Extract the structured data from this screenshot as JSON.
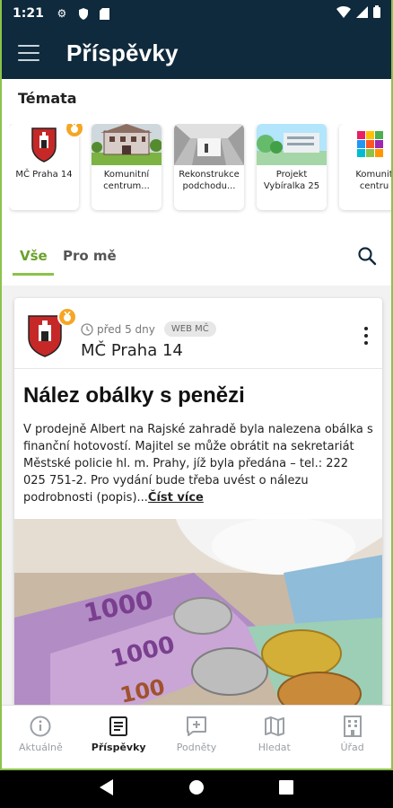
{
  "status": {
    "time": "1:21"
  },
  "appbar": {
    "title": "Příspěvky"
  },
  "topics": {
    "label": "Témata",
    "items": [
      {
        "label": "MČ Praha 14",
        "thumb": "coat-of-arms-icon",
        "badge": true
      },
      {
        "label": "Komunitní centrum...",
        "thumb": "building-photo"
      },
      {
        "label": "Rekonstrukce podchodu...",
        "thumb": "underpass-photo"
      },
      {
        "label": "Projekt Vybíralka 25",
        "thumb": "project-photo"
      },
      {
        "label": "Komunit centru",
        "thumb": "colorful-logo"
      }
    ]
  },
  "tabs": {
    "all": "Vše",
    "for_me": "Pro mě"
  },
  "post": {
    "time": "před 5 dny",
    "source_chip": "WEB MČ",
    "author": "MČ Praha 14",
    "title": "Nález obálky s penězi",
    "body": "V prodejně Albert na Rajské zahradě byla nalezena obálka s finanční hotovostí. Majitel se může obrátit na sekretariát Městské policie hl. m. Prahy, jíž byla předána – tel.: 222 025 751-2. Pro vydání bude třeba uvést o nálezu podrobnosti (popis)...",
    "read_more": "Číst více"
  },
  "bottom_nav": [
    {
      "label": "Aktuálně",
      "icon": "info-icon"
    },
    {
      "label": "Příspěvky",
      "icon": "posts-icon",
      "active": true
    },
    {
      "label": "Podněty",
      "icon": "add-comment-icon"
    },
    {
      "label": "Hledat",
      "icon": "map-icon"
    },
    {
      "label": "Úřad",
      "icon": "office-icon"
    }
  ],
  "colors": {
    "appbar": "#0f2a3c",
    "accent": "#8bc34a",
    "badge": "#f5a623"
  }
}
